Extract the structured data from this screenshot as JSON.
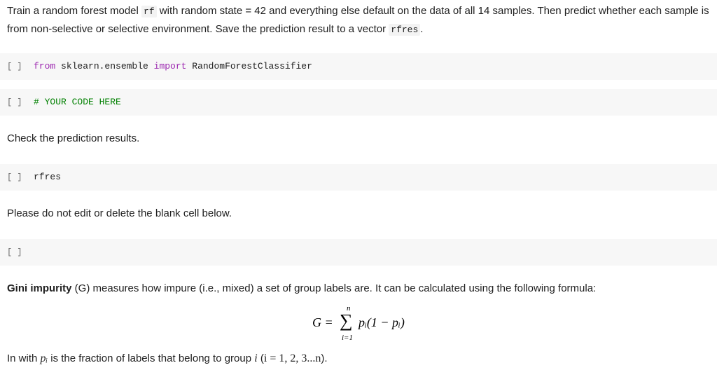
{
  "intro": {
    "text_1": "Train a random forest model ",
    "code_1": "rf",
    "text_2": " with random state = 42 and everything else default on the data of all 14 samples. Then predict whether each sample is from non-selective or selective environment. Save the prediction result to a vector ",
    "code_2": "rfres",
    "text_3": "."
  },
  "cells": [
    {
      "prompt": "[ ]",
      "kw_from": "from",
      "module": " sklearn.ensemble ",
      "kw_import": "import",
      "name": " RandomForestClassifier"
    },
    {
      "prompt": "[ ]",
      "comment": "# YOUR CODE HERE"
    },
    {
      "prompt": "[ ]",
      "code": "rfres"
    },
    {
      "prompt": "[ ]",
      "code": ""
    }
  ],
  "check_text": "Check the prediction results.",
  "blank_note": "Please do not edit or delete the blank cell below.",
  "gini": {
    "term": "Gini impurity",
    "text": " (G) measures how impure (i.e., mixed) a set of group labels are. It can be calculated using the following formula:"
  },
  "formula": {
    "lhs": "G =",
    "sigma": "∑",
    "upper": "n",
    "lower": "i=1",
    "body": "pᵢ(1 − pᵢ)"
  },
  "footer": {
    "text_1": "In with ",
    "var_p": "pᵢ",
    "text_2": " is the fraction of labels that belong to group ",
    "var_i": "i",
    "text_3": " (",
    "range": "i = 1, 2, 3...n",
    "text_4": ")."
  },
  "colors": {
    "cell_background": "#f7f7f7",
    "keyword": "#9c27b0",
    "comment": "#008000",
    "text": "#212121"
  }
}
